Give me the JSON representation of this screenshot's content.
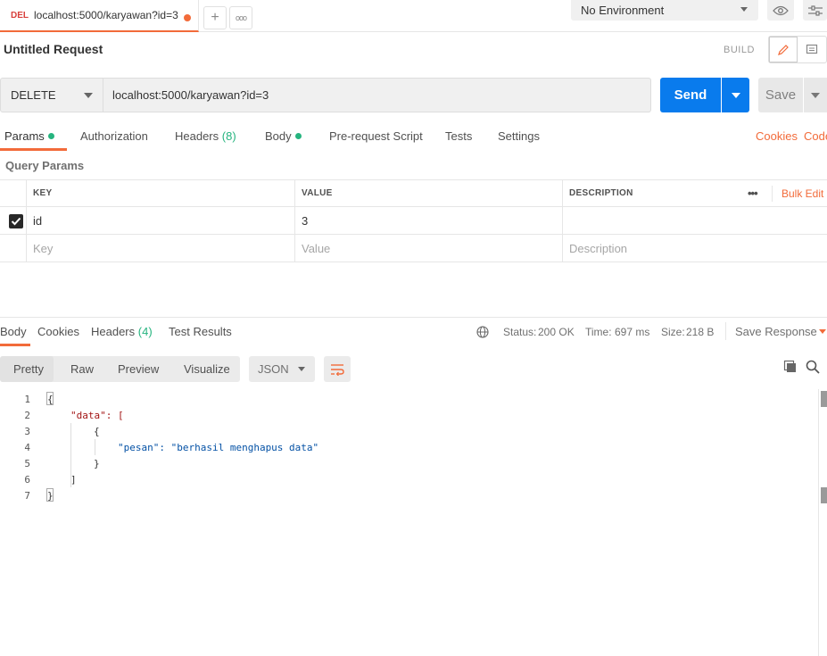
{
  "tab": {
    "method": "DEL",
    "url": "localhost:5000/karyawan?id=3"
  },
  "tabbar": {
    "add": "+",
    "more": "ooo"
  },
  "environment": {
    "selected": "No Environment"
  },
  "request": {
    "title": "Untitled Request",
    "build_label": "BUILD",
    "method": "DELETE",
    "url": "localhost:5000/karyawan?id=3",
    "send_label": "Send",
    "save_label": "Save"
  },
  "request_tabs": [
    {
      "label": "Params"
    },
    {
      "label": "Authorization"
    },
    {
      "label": "Headers",
      "count": "(8)"
    },
    {
      "label": "Body"
    },
    {
      "label": "Pre-request Script"
    },
    {
      "label": "Tests"
    },
    {
      "label": "Settings"
    }
  ],
  "right_links": {
    "cookies": "Cookies",
    "code": "Code"
  },
  "query_params": {
    "title": "Query Params",
    "headers": {
      "key": "KEY",
      "value": "VALUE",
      "description": "DESCRIPTION",
      "more": "•••",
      "bulk_edit": "Bulk Edit"
    },
    "rows": [
      {
        "key": "id",
        "value": "3",
        "description": "",
        "checked": true
      }
    ],
    "placeholders": {
      "key": "Key",
      "value": "Value",
      "description": "Description"
    }
  },
  "response_tabs": [
    {
      "label": "Body"
    },
    {
      "label": "Cookies"
    },
    {
      "label": "Headers",
      "count": "(4)"
    },
    {
      "label": "Test Results"
    }
  ],
  "response_status": {
    "status_label": "Status:",
    "status_value": "200 OK",
    "time_label": "Time:",
    "time_value": "697 ms",
    "size_label": "Size:",
    "size_value": "218 B",
    "save_response": "Save Response"
  },
  "view_modes": [
    "Pretty",
    "Raw",
    "Preview",
    "Visualize"
  ],
  "format": "JSON",
  "response_body": {
    "line_numbers": [
      "1",
      "2",
      "3",
      "4",
      "5",
      "6",
      "7"
    ],
    "lines": [
      "{",
      "\"data\": [",
      "{",
      "\"pesan\": \"berhasil menghapus data\"",
      "}",
      "]",
      "}"
    ]
  },
  "colors": {
    "accent": "#f26b3a",
    "send": "#097bed",
    "success": "#26b47f"
  }
}
